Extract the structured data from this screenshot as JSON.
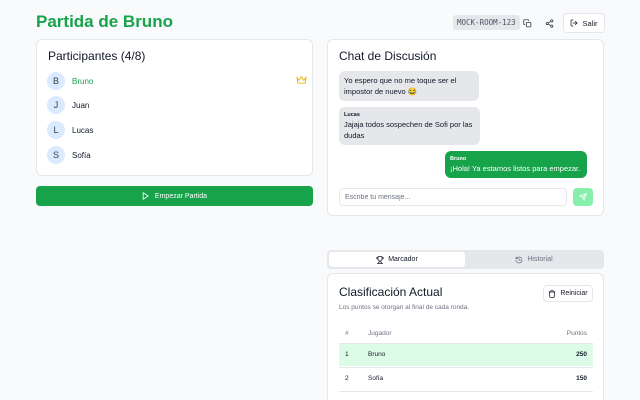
{
  "header": {
    "title": "Partida de Bruno",
    "room_code": "MOCK-ROOM-123",
    "exit_label": "Salir"
  },
  "participants": {
    "title": "Participantes (4/8)",
    "items": [
      {
        "initial": "B",
        "name": "Bruno",
        "host": true
      },
      {
        "initial": "J",
        "name": "Juan"
      },
      {
        "initial": "L",
        "name": "Lucas"
      },
      {
        "initial": "S",
        "name": "Sofía"
      }
    ],
    "start_label": "Empezar Partida"
  },
  "chat": {
    "title": "Chat de Discusión",
    "messages": [
      {
        "author": "",
        "text": "Yo espero que no me toque ser el impostor de nuevo 😂"
      },
      {
        "author": "Lucas",
        "text": "Jajaja todos sospechen de Sofi por las dudas"
      },
      {
        "author": "Bruno",
        "text": "¡Hola! Ya estamos listos para empezar."
      }
    ],
    "placeholder": "Escribe tu mensaje..."
  },
  "tabs": [
    {
      "label": "Marcador",
      "active": true
    },
    {
      "label": "Historial",
      "active": false
    }
  ],
  "scoreboard": {
    "title": "Clasificación Actual",
    "subtitle": "Los puntos se otorgan al final de cada ronda.",
    "reset_label": "Reiniciar",
    "columns": [
      "#",
      "Jugador",
      "Puntos"
    ],
    "rows": [
      {
        "rank": "1",
        "player": "Bruno",
        "points": "250"
      },
      {
        "rank": "2",
        "player": "Sofía",
        "points": "150"
      }
    ]
  },
  "colors": {
    "accent": "#16a34a",
    "accent_light": "#dcfce7",
    "crown": "#eab308"
  }
}
